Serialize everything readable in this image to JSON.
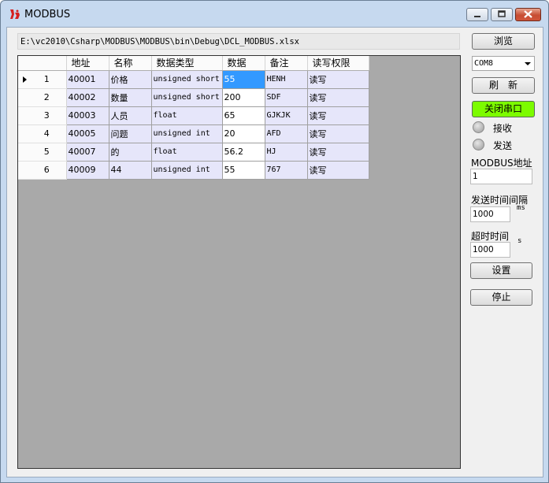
{
  "window": {
    "title": "MODBUS"
  },
  "path": "E:\\vc2010\\Csharp\\MODBUS\\MODBUS\\bin\\Debug\\DCL_MODBUS.xlsx",
  "table": {
    "columns": [
      "地址",
      "名称",
      "数据类型",
      "数据",
      "备注",
      "读写权限"
    ],
    "rows": [
      {
        "num": "1",
        "addr": "40001",
        "name": "价格",
        "type": "unsigned short",
        "data": "55",
        "note": "HENH",
        "rw": "读写"
      },
      {
        "num": "2",
        "addr": "40002",
        "name": "数量",
        "type": "unsigned short",
        "data": "200",
        "note": "SDF",
        "rw": "读写"
      },
      {
        "num": "3",
        "addr": "40003",
        "name": "人员",
        "type": "float",
        "data": "65",
        "note": "GJKJK",
        "rw": "读写"
      },
      {
        "num": "4",
        "addr": "40005",
        "name": "问题",
        "type": "unsigned int",
        "data": "20",
        "note": "AFD",
        "rw": "读写"
      },
      {
        "num": "5",
        "addr": "40007",
        "name": "的",
        "type": "float",
        "data": "56.2",
        "note": "HJ",
        "rw": "读写"
      },
      {
        "num": "6",
        "addr": "40009",
        "name": "44",
        "type": "unsigned int",
        "data": "55",
        "note": "767",
        "rw": "读写"
      }
    ]
  },
  "controls": {
    "browse": "浏览",
    "port": "COM8",
    "refresh": "刷　新",
    "close_port": "关闭串口",
    "receive": "接收",
    "send": "发送",
    "modbus_addr_label": "MODBUS地址",
    "modbus_addr": "1",
    "send_interval_label": "发送时间间隔",
    "send_interval": "1000",
    "send_interval_unit": "ms",
    "timeout_label": "超时时间",
    "timeout": "1000",
    "timeout_unit": "s",
    "settings": "设置",
    "stop": "停止"
  },
  "colors": {
    "close_port_bg": "#7cfc00",
    "row_bg": "#e6e6fa",
    "selected_cell": "#3399ff"
  }
}
